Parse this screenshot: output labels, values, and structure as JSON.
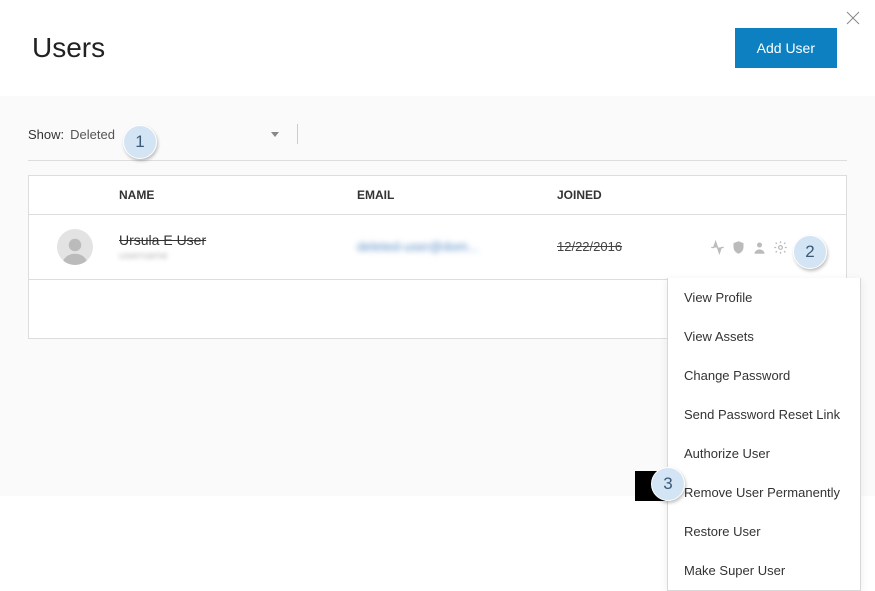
{
  "header": {
    "title": "Users",
    "add_user_label": "Add User"
  },
  "filter": {
    "show_label": "Show:",
    "value": "Deleted"
  },
  "table": {
    "headers": {
      "name": "NAME",
      "email": "EMAIL",
      "joined": "JOINED"
    },
    "rows": [
      {
        "name": "Ursula E User",
        "sub": "username",
        "email": "deleted-user@dom...",
        "joined": "12/22/2016"
      }
    ]
  },
  "menu": {
    "items": [
      "View Profile",
      "View Assets",
      "Change Password",
      "Send Password Reset Link",
      "Authorize User",
      "Remove User Permanently",
      "Restore User",
      "Make Super User"
    ]
  },
  "callouts": {
    "c1": "1",
    "c2": "2",
    "c3": "3"
  }
}
